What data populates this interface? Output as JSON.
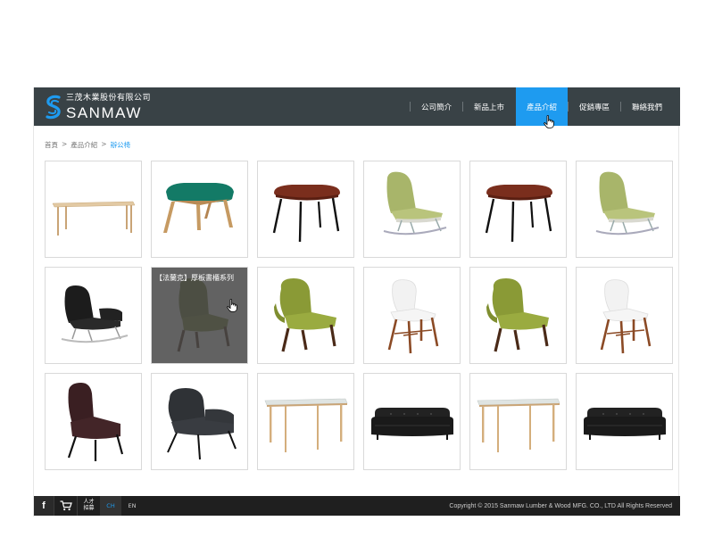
{
  "header": {
    "logo_cn": "三茂木業股份有限公司",
    "logo_en": "SANMAW",
    "nav": [
      {
        "label": "公司簡介"
      },
      {
        "label": "新品上市"
      },
      {
        "label": "產品介紹",
        "active": true
      },
      {
        "label": "促銷專區"
      },
      {
        "label": "聯絡我們"
      }
    ]
  },
  "breadcrumb": {
    "home": "首頁",
    "sep": ">",
    "section": "產品介紹",
    "current": "辦公椅"
  },
  "products": [
    {
      "icon": "table-icon"
    },
    {
      "icon": "teal-ottoman-icon"
    },
    {
      "icon": "brown-ottoman-icon"
    },
    {
      "icon": "green-rocking-chair-icon"
    },
    {
      "icon": "brown-ottoman-icon"
    },
    {
      "icon": "green-rocking-chair-icon"
    },
    {
      "icon": "black-rocking-chair-icon"
    },
    {
      "icon": "green-lounge-chair-icon",
      "hover_title": "【法蘭克】厚板書櫃系列"
    },
    {
      "icon": "green-lounge-chair-icon"
    },
    {
      "icon": "white-chair-icon"
    },
    {
      "icon": "green-lounge-chair-icon"
    },
    {
      "icon": "white-chair-icon"
    },
    {
      "icon": "maroon-lounge-chair-icon"
    },
    {
      "icon": "grey-lounge-chair-icon"
    },
    {
      "icon": "dining-table-icon"
    },
    {
      "icon": "black-sofa-icon"
    },
    {
      "icon": "dining-table-icon"
    },
    {
      "icon": "black-sofa-icon"
    }
  ],
  "footer": {
    "facebook": "f",
    "recruit_line1": "人才",
    "recruit_line2": "招募",
    "lang_ch": "CH",
    "lang_en": "EN",
    "copyright": "Copyright © 2015 Sanmaw Lumber & Wood MFG. CO., LTD All Rights Reserved"
  },
  "colors": {
    "header_bg": "#394246",
    "accent": "#1e9bf0",
    "footer_bg": "#1f1f1f"
  }
}
